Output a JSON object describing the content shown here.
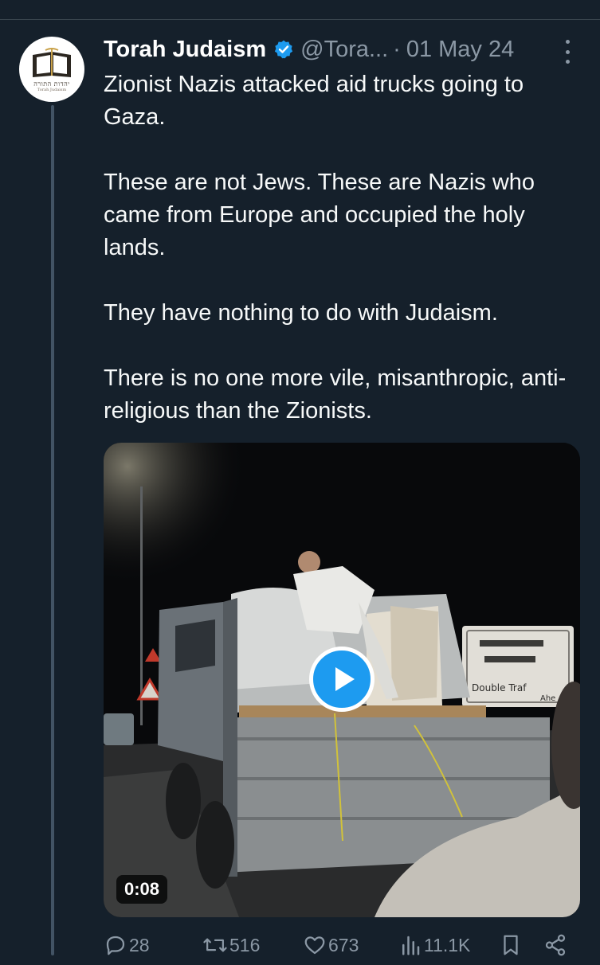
{
  "tweet": {
    "author_name": "Torah Judaism",
    "handle": "@Tora...",
    "separator": "·",
    "date": "01 May 24",
    "avatar_caption": "יהדות התורה",
    "avatar_subcaption": "Torah Judaism",
    "paragraphs": [
      "Zionist Nazis attacked aid trucks going to Gaza.",
      "These are not Jews. These are Nazis who came from Europe and occupied the holy lands.",
      "They have nothing to do with Judaism.",
      "There is no one more vile, misanthropic, anti-religious than the Zionists."
    ]
  },
  "media": {
    "duration": "0:08",
    "sign_text": "Double Traf",
    "sign_text_2": "Ahe"
  },
  "actions": {
    "replies": "28",
    "reposts": "516",
    "likes": "673",
    "views": "11.1K"
  },
  "colors": {
    "background": "#15202b",
    "accent": "#1d9bf0",
    "muted": "#8b98a5",
    "text": "#f7f9f9"
  },
  "icons": [
    "verified-badge-icon",
    "more-vertical-icon",
    "play-icon",
    "reply-icon",
    "repost-icon",
    "like-icon",
    "views-icon",
    "bookmark-icon",
    "share-icon"
  ]
}
